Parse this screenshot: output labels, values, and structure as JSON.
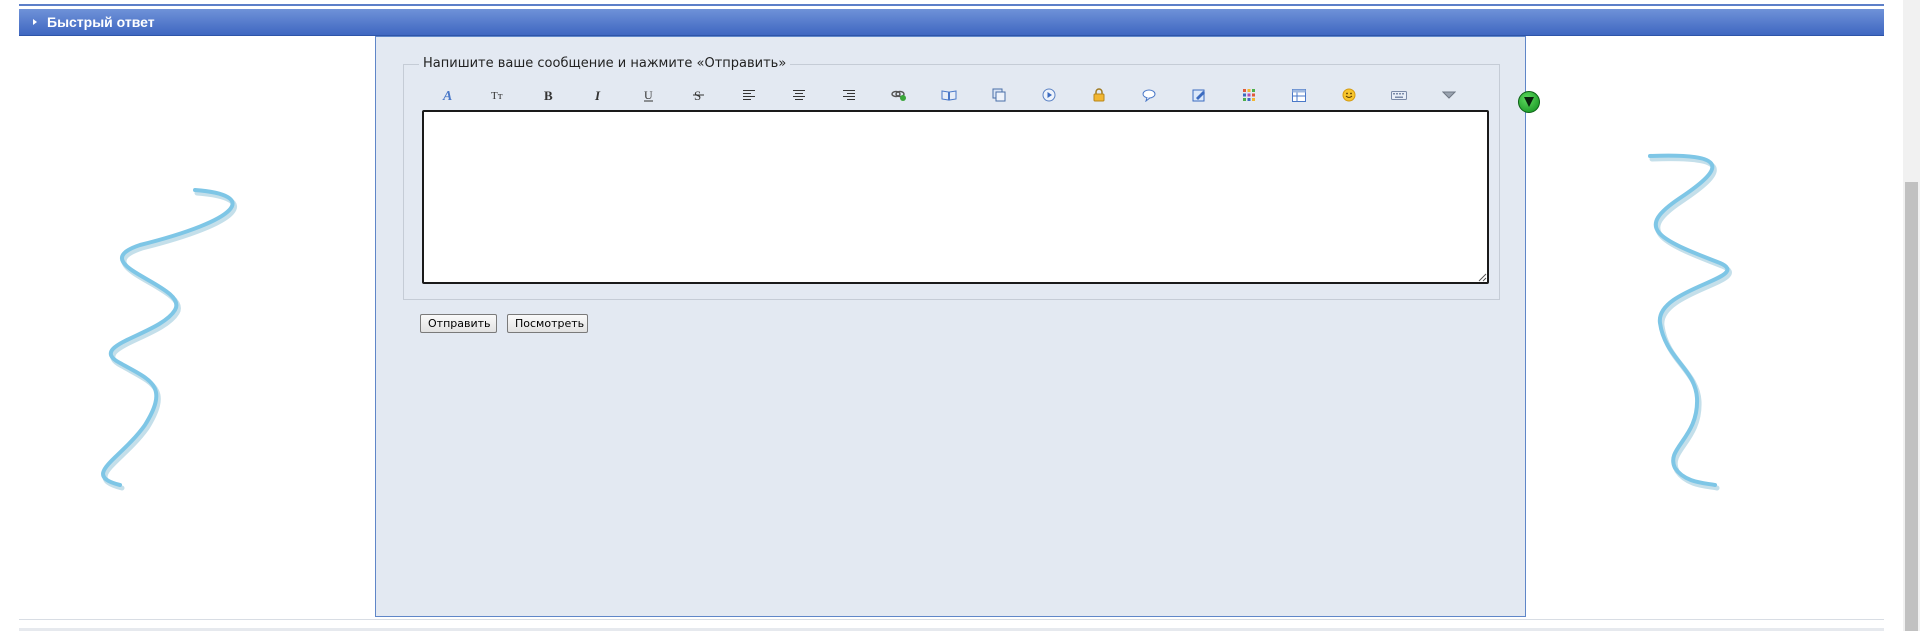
{
  "header": {
    "title": "Быстрый ответ"
  },
  "reply_form": {
    "legend": "Напишите ваше сообщение и нажмите «Отправить»",
    "message_value": "",
    "toolbar": [
      {
        "name": "font-icon",
        "glyph": "A"
      },
      {
        "name": "font-size-icon",
        "glyph": "Tт"
      },
      {
        "name": "bold-icon",
        "glyph": "B"
      },
      {
        "name": "italic-icon",
        "glyph": "I"
      },
      {
        "name": "underline-icon",
        "glyph": "U"
      },
      {
        "name": "strikethrough-icon",
        "glyph": "S"
      },
      {
        "name": "align-left-icon",
        "glyph": ""
      },
      {
        "name": "align-center-icon",
        "glyph": ""
      },
      {
        "name": "align-right-icon",
        "glyph": ""
      },
      {
        "name": "link-icon",
        "glyph": ""
      },
      {
        "name": "book-icon",
        "glyph": ""
      },
      {
        "name": "copy-icon",
        "glyph": ""
      },
      {
        "name": "play-icon",
        "glyph": ""
      },
      {
        "name": "lock-icon",
        "glyph": ""
      },
      {
        "name": "speech-bubble-icon",
        "glyph": ""
      },
      {
        "name": "edit-icon",
        "glyph": ""
      },
      {
        "name": "color-palette-icon",
        "glyph": ""
      },
      {
        "name": "table-icon",
        "glyph": ""
      },
      {
        "name": "smiley-icon",
        "glyph": ""
      },
      {
        "name": "keyboard-icon",
        "glyph": ""
      },
      {
        "name": "more-dropdown-icon",
        "glyph": ""
      }
    ],
    "send_label": "Отправить",
    "preview_label": "Посмотреть"
  },
  "colors": {
    "header_bar": "#4a72c8",
    "panel_background": "#e3e9f2",
    "squiggle": "#7ec6e6"
  }
}
